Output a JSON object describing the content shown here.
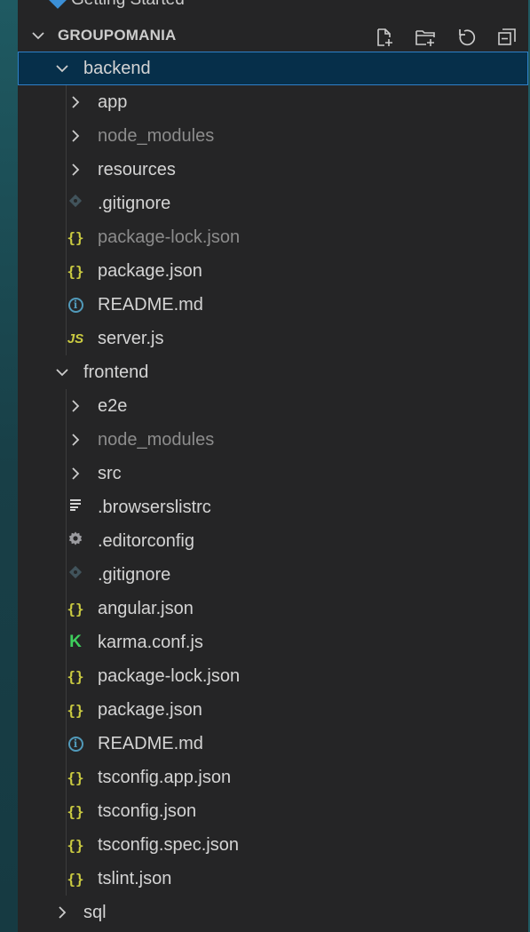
{
  "window": {
    "top_partial": "Getting Started"
  },
  "explorer": {
    "section_title": "GROUPOMANIA",
    "actions": [
      {
        "name": "new-file-icon",
        "label": "New File"
      },
      {
        "name": "new-folder-icon",
        "label": "New Folder"
      },
      {
        "name": "refresh-icon",
        "label": "Refresh Explorer"
      },
      {
        "name": "collapse-all-icon",
        "label": "Collapse Folders"
      }
    ]
  },
  "colors": {
    "selected_bg": "#062f4a",
    "selected_border": "#2f80c8",
    "json_icon": "#cbcb41",
    "info_icon": "#519aba",
    "karma_icon": "#3ecf5c",
    "ignored_text": "#8c8c8c"
  },
  "tree": [
    {
      "label": "backend",
      "kind": "folder",
      "expanded": true,
      "selected": true
    },
    {
      "label": "app",
      "kind": "folder",
      "expanded": false,
      "selected": false
    },
    {
      "label": "node_modules",
      "kind": "folder",
      "expanded": false,
      "dim": true
    },
    {
      "label": "resources",
      "kind": "folder",
      "expanded": false
    },
    {
      "label": ".gitignore",
      "kind": "file",
      "icon": "git-icon"
    },
    {
      "label": "package-lock.json",
      "kind": "file",
      "icon": "json-icon",
      "dim": true
    },
    {
      "label": "package.json",
      "kind": "file",
      "icon": "json-icon"
    },
    {
      "label": "README.md",
      "kind": "file",
      "icon": "info-icon"
    },
    {
      "label": "server.js",
      "kind": "file",
      "icon": "js-icon"
    },
    {
      "label": "frontend",
      "kind": "folder",
      "expanded": true
    },
    {
      "label": "e2e",
      "kind": "folder",
      "expanded": false
    },
    {
      "label": "node_modules",
      "kind": "folder",
      "expanded": false,
      "dim": true
    },
    {
      "label": "src",
      "kind": "folder",
      "expanded": false
    },
    {
      "label": ".browserslistrc",
      "kind": "file",
      "icon": "lines-icon"
    },
    {
      "label": ".editorconfig",
      "kind": "file",
      "icon": "gear-icon"
    },
    {
      "label": ".gitignore",
      "kind": "file",
      "icon": "git-icon"
    },
    {
      "label": "angular.json",
      "kind": "file",
      "icon": "json-icon"
    },
    {
      "label": "karma.conf.js",
      "kind": "file",
      "icon": "karma-icon"
    },
    {
      "label": "package-lock.json",
      "kind": "file",
      "icon": "json-icon"
    },
    {
      "label": "package.json",
      "kind": "file",
      "icon": "json-icon"
    },
    {
      "label": "README.md",
      "kind": "file",
      "icon": "info-icon"
    },
    {
      "label": "tsconfig.app.json",
      "kind": "file",
      "icon": "json-icon"
    },
    {
      "label": "tsconfig.json",
      "kind": "file",
      "icon": "json-icon"
    },
    {
      "label": "tsconfig.spec.json",
      "kind": "file",
      "icon": "json-icon"
    },
    {
      "label": "tslint.json",
      "kind": "file",
      "icon": "json-icon"
    },
    {
      "label": "sql",
      "kind": "folder",
      "expanded": false
    }
  ]
}
